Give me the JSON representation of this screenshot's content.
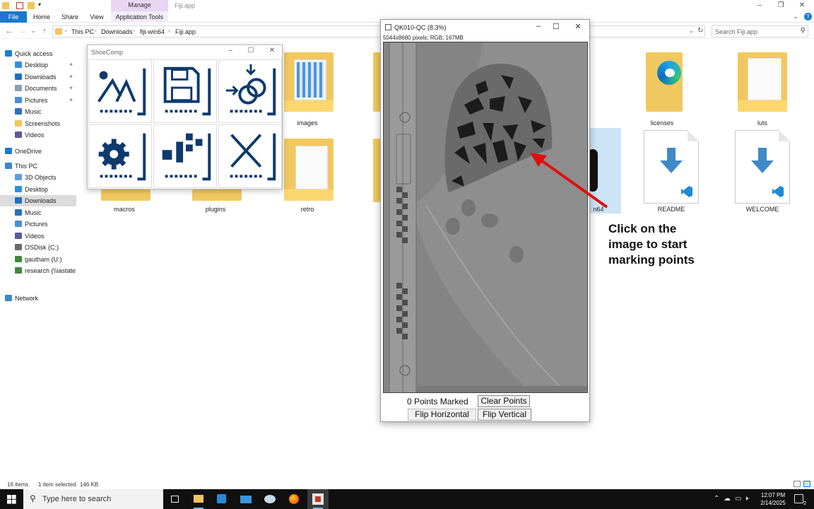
{
  "explorer": {
    "title": "Fiji.app",
    "manage_tab": "Manage",
    "tabs": [
      "File",
      "Home",
      "Share",
      "View",
      "Application Tools"
    ],
    "breadcrumb": [
      "This PC",
      "Downloads",
      "fiji-win64",
      "Fiji.app"
    ],
    "search_placeholder": "Search Fiji.app",
    "nav": [
      {
        "label": "Quick access",
        "icon": "star-icon",
        "color": "#1b7fd6"
      },
      {
        "label": "Desktop",
        "icon": "desktop-icon",
        "color": "#2f8fe0",
        "pinned": true
      },
      {
        "label": "Downloads",
        "icon": "download-icon",
        "color": "#1e6fc4",
        "pinned": true
      },
      {
        "label": "Documents",
        "icon": "documents-icon",
        "color": "#8a9db3",
        "pinned": true
      },
      {
        "label": "Pictures",
        "icon": "pictures-icon",
        "color": "#4a8fd6",
        "pinned": true
      },
      {
        "label": "Music",
        "icon": "music-icon",
        "color": "#2a6fc0"
      },
      {
        "label": "Screenshots",
        "icon": "folder-icon",
        "color": "#f2c55c"
      },
      {
        "label": "Videos",
        "icon": "videos-icon",
        "color": "#5a5a9a"
      },
      {
        "label": "OneDrive",
        "icon": "cloud-icon",
        "color": "#1a7ad6"
      },
      {
        "label": "This PC",
        "icon": "pc-icon",
        "color": "#3a86d0"
      },
      {
        "label": "3D Objects",
        "icon": "cube-icon",
        "color": "#5aa0e0"
      },
      {
        "label": "Desktop",
        "icon": "desktop-icon",
        "color": "#2f8fe0"
      },
      {
        "label": "Downloads",
        "icon": "download-icon",
        "color": "#1e6fc4"
      },
      {
        "label": "Music",
        "icon": "music-icon",
        "color": "#2a6fc0"
      },
      {
        "label": "Pictures",
        "icon": "pictures-icon",
        "color": "#4a8fd6"
      },
      {
        "label": "Videos",
        "icon": "videos-icon",
        "color": "#5a5a9a"
      },
      {
        "label": "OSDisk (C:)",
        "icon": "drive-icon",
        "color": "#6b6b6b"
      },
      {
        "label": "gautham (U:)",
        "icon": "network-drive-icon",
        "color": "#3c8a3c"
      },
      {
        "label": "research (\\\\iastate.e",
        "icon": "network-drive-icon",
        "color": "#3c8a3c"
      },
      {
        "label": "Network",
        "icon": "network-icon",
        "color": "#3a86d0"
      }
    ],
    "files": [
      {
        "label": "images",
        "kind": "folder"
      },
      {
        "label": "licenses",
        "kind": "folder-edge"
      },
      {
        "label": "luts",
        "kind": "folder"
      },
      {
        "label": "macros",
        "kind": "folder"
      },
      {
        "label": "plugins",
        "kind": "folder"
      },
      {
        "label": "retro",
        "kind": "folder"
      },
      {
        "label": "n64",
        "kind": "app"
      },
      {
        "label": "README",
        "kind": "vscode-doc"
      },
      {
        "label": "WELCOME",
        "kind": "vscode-doc"
      }
    ],
    "status": {
      "items": "16 items",
      "selected": "1 item selected",
      "size": "146 KB"
    }
  },
  "shoecomp": {
    "title": "ShoeComp",
    "buttons": [
      {
        "name": "load-button",
        "icon": "load-shoeprint-icon"
      },
      {
        "name": "save-button",
        "icon": "floppy-disk-icon"
      },
      {
        "name": "compare-button",
        "icon": "overlap-circles-icon"
      },
      {
        "name": "settings-button",
        "icon": "gear-icon"
      },
      {
        "name": "plugins-button",
        "icon": "blocks-icon"
      },
      {
        "name": "exit-button",
        "icon": "x-mark-icon"
      }
    ],
    "accent": "#0e3a6e"
  },
  "imagej": {
    "title": "QK010-QC (8.3%)",
    "info": "5044x8680 pixels; RGB; 167MB",
    "points_marked": "0 Points Marked",
    "clear_points": "Clear Points",
    "flip_horizontal": "Flip Horizontal",
    "flip_vertical": "Flip Vertical"
  },
  "annotation": {
    "text": "Click on the\nimage to start\nmarking points",
    "arrow_color": "#e01010"
  },
  "taskbar": {
    "search_placeholder": "Type here to search",
    "time": "12:07 PM",
    "date": "2/14/2025",
    "notification_count": "2"
  }
}
